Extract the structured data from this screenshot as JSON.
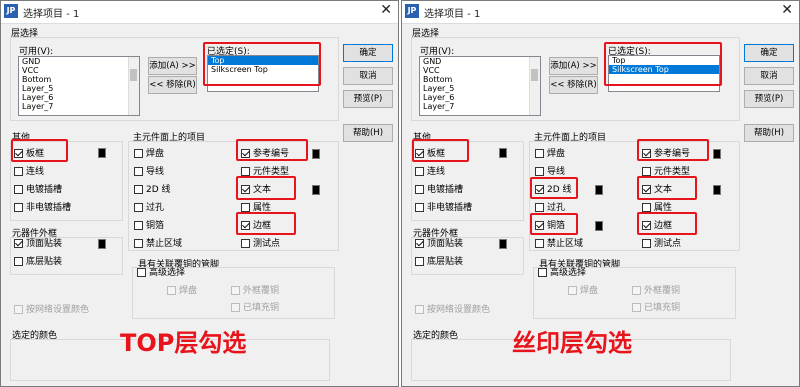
{
  "window": {
    "title": "选择项目 - 1",
    "icon_text": "JP"
  },
  "layer_section": {
    "label": "层选择",
    "available_label": "可用(V):",
    "available_items": [
      "GND",
      "VCC",
      "Bottom",
      "Layer_5",
      "Layer_6",
      "Layer_7"
    ],
    "selected_label": "已选定(S):",
    "selected_items": [
      "Top",
      "Silkscreen Top"
    ],
    "add_button": "添加(A) >>",
    "remove_button": "<< 移除(R)"
  },
  "buttons": {
    "ok": "确定",
    "cancel": "取消",
    "preview": "预览(P)",
    "help": "帮助(H)"
  },
  "other": {
    "label": "其他",
    "board_outline": "板框",
    "connection": "连线",
    "plated_slot": "电镀插槽",
    "nonplated_slot": "非电镀插槽"
  },
  "components_outline": {
    "label": "元器件外框",
    "top_mount": "顶面贴装",
    "bottom_mount": "底层贴装"
  },
  "net_color": {
    "label": "按网络设置颜色"
  },
  "main_items": {
    "label": "主元件面上的项目",
    "pad": "焊盘",
    "trace": "导线",
    "line_2d": "2D 线",
    "via": "过孔",
    "copper": "铜箔",
    "keepout": "禁止区域",
    "ref_des": "参考编号",
    "part_type": "元件类型",
    "text": "文本",
    "attribute": "属性",
    "outline": "边框",
    "test_point": "测试点"
  },
  "pour_section": {
    "label": "具有关联覆铜的管脚",
    "advanced": "高级选择",
    "pad": "焊盘",
    "outer_copper": "外框覆铜",
    "filled_copper": "已填充铜"
  },
  "selected_color_label": "选定的颜色",
  "panels": [
    {
      "id": "left",
      "caption": "TOP层勾选",
      "selected_index": 0,
      "checks": {
        "board_outline": true,
        "connection": false,
        "plated_slot": false,
        "nonplated_slot": false,
        "top_mount": true,
        "bottom_mount": false,
        "pad": false,
        "trace": false,
        "line_2d": false,
        "via": false,
        "copper": false,
        "keepout": false,
        "ref_des": true,
        "part_type": false,
        "text": true,
        "attribute": false,
        "outline": true,
        "test_point": false,
        "advanced": false
      }
    },
    {
      "id": "right",
      "caption": "丝印层勾选",
      "selected_index": 1,
      "checks": {
        "board_outline": true,
        "connection": false,
        "plated_slot": false,
        "nonplated_slot": false,
        "top_mount": true,
        "bottom_mount": false,
        "pad": false,
        "trace": false,
        "line_2d": true,
        "via": false,
        "copper": true,
        "keepout": false,
        "ref_des": true,
        "part_type": false,
        "text": true,
        "attribute": false,
        "outline": true,
        "test_point": false,
        "advanced": false
      }
    }
  ],
  "colors": {
    "highlight": "#e8141c",
    "selection": "#0078d7",
    "swatch": "#000000"
  }
}
